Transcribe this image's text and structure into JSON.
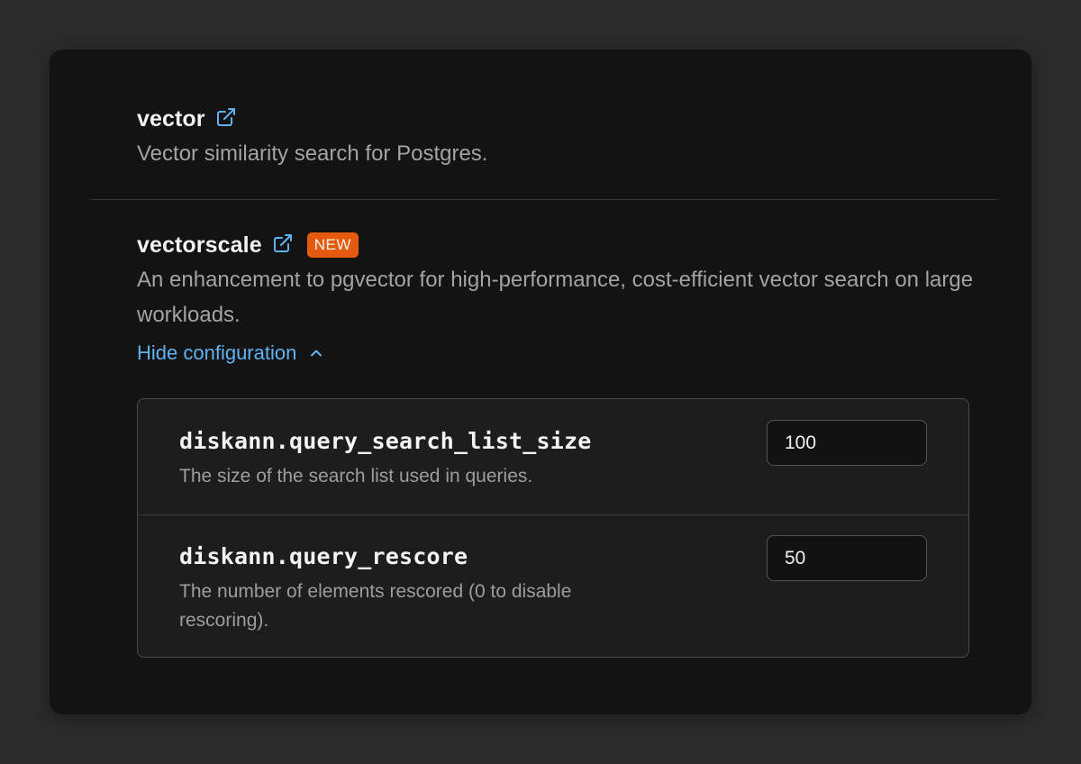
{
  "extensions": [
    {
      "name": "vector",
      "description": "Vector similarity search for Postgres."
    },
    {
      "name": "vectorscale",
      "badge": "NEW",
      "description": "An enhancement to pgvector for high-performance, cost-efficient vector search on large workloads.",
      "toggle_label": "Hide configuration",
      "config": [
        {
          "name": "diskann.query_search_list_size",
          "description": "The size of the search list used in queries.",
          "value": "100"
        },
        {
          "name": "diskann.query_rescore",
          "description": "The number of elements rescored (0 to disable rescoring).",
          "value": "50"
        }
      ]
    }
  ],
  "colors": {
    "accent_link": "#5fb3f2",
    "badge_bg": "#e65a0e",
    "card_bg": "#131313",
    "page_bg": "#2b2b2b"
  },
  "icons": {
    "external_link": "external-link-icon",
    "toggle": "chevron-up-icon"
  }
}
